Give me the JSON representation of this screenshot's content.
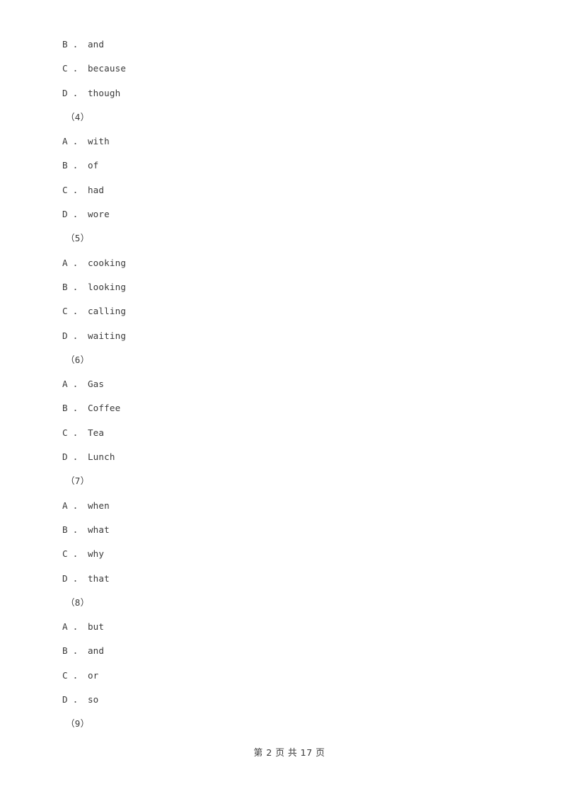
{
  "document": {
    "page_background": "#ffffff",
    "text_color": "#3a3a3a"
  },
  "body_lines": [
    {
      "kind": "option",
      "text": "B ． and"
    },
    {
      "kind": "option",
      "text": "C ． because"
    },
    {
      "kind": "option",
      "text": "D ． though"
    },
    {
      "kind": "qnum",
      "text": "（4）"
    },
    {
      "kind": "option",
      "text": "A ． with"
    },
    {
      "kind": "option",
      "text": "B ． of"
    },
    {
      "kind": "option",
      "text": "C ． had"
    },
    {
      "kind": "option",
      "text": "D ． wore"
    },
    {
      "kind": "qnum",
      "text": "（5）"
    },
    {
      "kind": "option",
      "text": "A ． cooking"
    },
    {
      "kind": "option",
      "text": "B ． looking"
    },
    {
      "kind": "option",
      "text": "C ． calling"
    },
    {
      "kind": "option",
      "text": "D ． waiting"
    },
    {
      "kind": "qnum",
      "text": "（6）"
    },
    {
      "kind": "option",
      "text": "A ． Gas"
    },
    {
      "kind": "option",
      "text": "B ． Coffee"
    },
    {
      "kind": "option",
      "text": "C ． Tea"
    },
    {
      "kind": "option",
      "text": "D ． Lunch"
    },
    {
      "kind": "qnum",
      "text": "（7）"
    },
    {
      "kind": "option",
      "text": "A ． when"
    },
    {
      "kind": "option",
      "text": "B ． what"
    },
    {
      "kind": "option",
      "text": "C ． why"
    },
    {
      "kind": "option",
      "text": "D ． that"
    },
    {
      "kind": "qnum",
      "text": "（8）"
    },
    {
      "kind": "option",
      "text": "A ． but"
    },
    {
      "kind": "option",
      "text": "B ． and"
    },
    {
      "kind": "option",
      "text": "C ． or"
    },
    {
      "kind": "option",
      "text": "D ． so"
    },
    {
      "kind": "qnum",
      "text": "（9）"
    }
  ],
  "footer": {
    "page_label": "第 2 页 共 17 页",
    "current_page": "2",
    "total_pages": "17"
  }
}
